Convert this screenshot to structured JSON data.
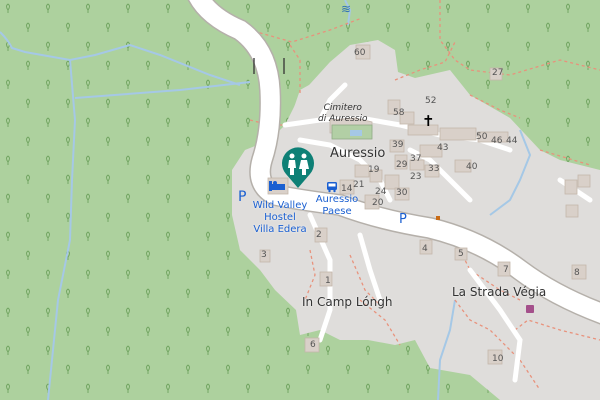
{
  "map": {
    "colors": {
      "forest": "#add19e",
      "residential": "#dfdddb",
      "building": "#d9d0c9",
      "road": "#ffffff",
      "road_casing": "#b5b0aa",
      "stream": "#a5c8e6",
      "path": "#e8927c",
      "pin": "#0e8076",
      "blue_label": "#1a5fd1",
      "text": "#555555"
    },
    "labels": {
      "village": "Auressio",
      "cemetery_line1": "Cimitero",
      "cemetery_line2": "di Auressio",
      "hostel_line1": "Wild Valley",
      "hostel_line2": "Hostel",
      "hostel_line3": "Villa Edera",
      "bus_line1": "Auressio",
      "bus_line2": "Paese",
      "camp": "In Camp Lóngh",
      "strada": "La Strada Végia",
      "parking_left": "P",
      "parking_road": "P"
    },
    "house_numbers": [
      "60",
      "58",
      "52",
      "50",
      "46",
      "44",
      "43",
      "39",
      "37",
      "33",
      "40",
      "29",
      "19",
      "23",
      "21",
      "24",
      "30",
      "14",
      "20",
      "2",
      "3",
      "4",
      "5",
      "1",
      "6",
      "7",
      "8",
      "10",
      "27",
      "24"
    ],
    "icons": [
      "toilets-icon",
      "hotel-icon",
      "bus-stop-icon",
      "place-of-worship-icon",
      "waterway-icon",
      "artwork-icon"
    ]
  }
}
